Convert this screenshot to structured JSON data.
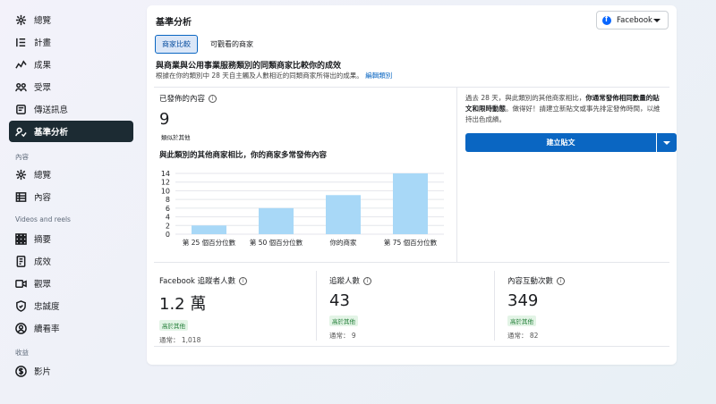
{
  "sidebar": {
    "items_top": [
      {
        "label": "總覽",
        "icon": "overview-icon"
      },
      {
        "label": "計畫",
        "icon": "plan-list-icon"
      },
      {
        "label": "成果",
        "icon": "results-line-icon"
      },
      {
        "label": "受眾",
        "icon": "audience-icon"
      },
      {
        "label": "傳送訊息",
        "icon": "messages-icon"
      },
      {
        "label": "基準分析",
        "icon": "benchmark-icon"
      }
    ],
    "section_content": "內容",
    "items_content": [
      {
        "label": "總覽",
        "icon": "content-overview-icon"
      },
      {
        "label": "內容",
        "icon": "content-table-icon"
      }
    ],
    "section_videos": "Videos and reels",
    "items_videos": [
      {
        "label": "摘要",
        "icon": "summary-grid-icon"
      },
      {
        "label": "成效",
        "icon": "performance-doc-icon"
      },
      {
        "label": "觀眾",
        "icon": "viewers-video-icon"
      },
      {
        "label": "忠誠度",
        "icon": "loyalty-shield-icon"
      },
      {
        "label": "續看率",
        "icon": "retention-person-icon"
      }
    ],
    "section_income": "收益",
    "items_income": [
      {
        "label": "影片",
        "icon": "dollar-icon"
      }
    ]
  },
  "main": {
    "title": "基準分析",
    "platform_select": "Facebook",
    "tabs": [
      {
        "label": "商家比較",
        "active": true
      },
      {
        "label": "可觀看的商家",
        "active": false
      }
    ],
    "headline": "與商業與公用事業服務類別的同類商家比較你的成效",
    "subline": "根據在你的類別中 28 天自主觸及人數相近的同類商家所得出的成果。",
    "edit_link": "編輯類別",
    "published": {
      "label": "已發佈的內容",
      "value": "9",
      "sub": "類似於其他"
    },
    "chart_title": "與此類別的其他商家相比，你的商家多常發佈內容",
    "right_text_1": "過去 28 天，與此類別的其他商家相比，",
    "right_text_bold": "你通常發佈相同數量的貼文和限時動態",
    "right_text_2": "。做得好！請建立新貼文或事先排定發佈時間，以維持出色成績。",
    "create_button": "建立貼文",
    "metrics": [
      {
        "label": "Facebook 追蹤者人數",
        "value": "1.2 萬",
        "badge": "高於其他",
        "avg": "通常： 1,018"
      },
      {
        "label": "追蹤人數",
        "value": "43",
        "badge": "高於其他",
        "avg": "通常： 9"
      },
      {
        "label": "內容互動次數",
        "value": "349",
        "badge": "高於其他",
        "avg": "通常： 82"
      }
    ]
  },
  "chart_data": {
    "type": "bar",
    "categories": [
      "第 25 個百分位數",
      "第 50 個百分位數",
      "你的商家",
      "第 75 個百分位數"
    ],
    "values": [
      2,
      6,
      9,
      14
    ],
    "ylim": [
      0,
      14
    ],
    "yticks": [
      0,
      2,
      4,
      6,
      8,
      10,
      12,
      14
    ],
    "grid": true,
    "bar_color": "#a8d8f7"
  }
}
